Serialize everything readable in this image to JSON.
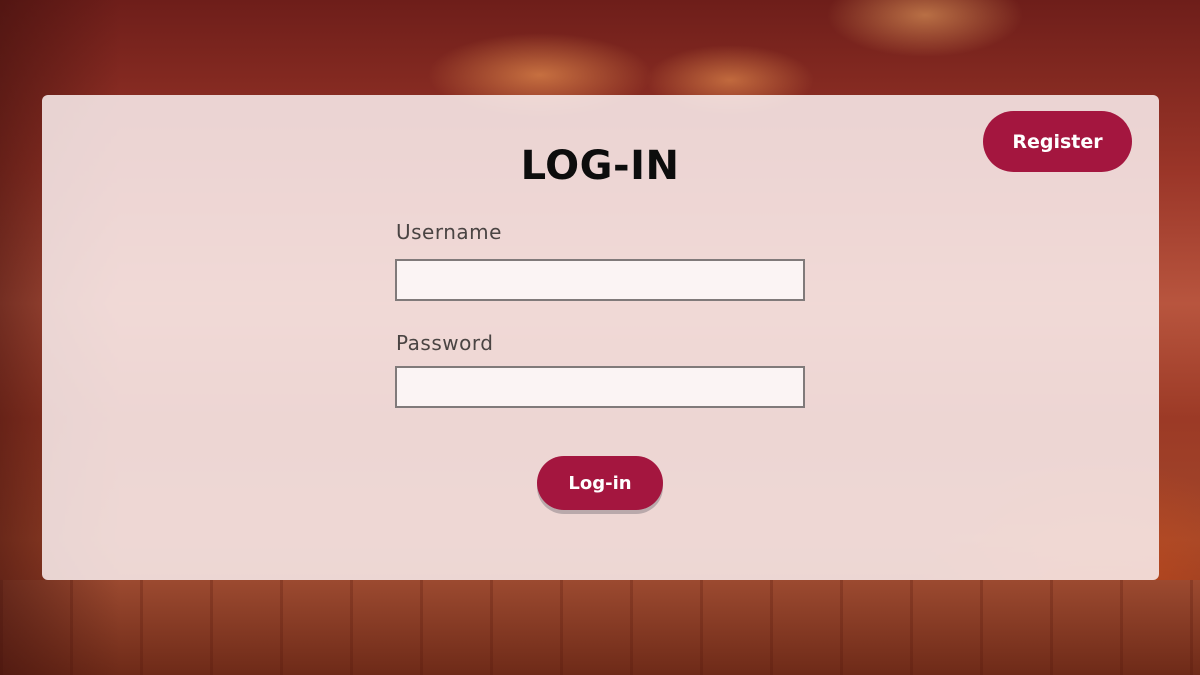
{
  "page": {
    "title": "LOG-IN",
    "background": "restaurant-interior-image"
  },
  "header": {
    "register_label": "Register"
  },
  "form": {
    "username": {
      "label": "Username",
      "value": "",
      "placeholder": ""
    },
    "password": {
      "label": "Password",
      "value": "",
      "placeholder": ""
    },
    "submit_label": "Log-in"
  },
  "colors": {
    "accent": "#a4163f",
    "card": "#f8ecec",
    "title_text": "#0d0d0d",
    "label_text": "#4a4443"
  }
}
